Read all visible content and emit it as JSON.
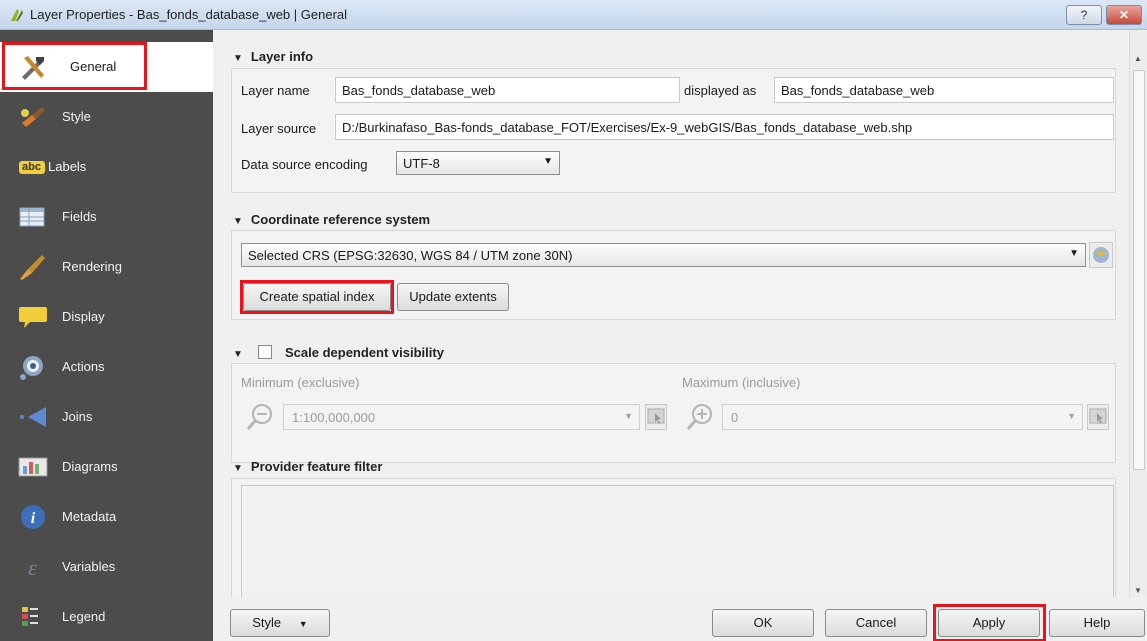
{
  "window": {
    "title": "Layer Properties - Bas_fonds_database_web | General",
    "help_glyph": "?",
    "close_glyph": "✕"
  },
  "sidebar": {
    "items": [
      {
        "label": "General",
        "icon": "tools-icon"
      },
      {
        "label": "Style",
        "icon": "paintbrush-icon"
      },
      {
        "label": "Labels",
        "icon": "abc-label-icon"
      },
      {
        "label": "Fields",
        "icon": "table-icon"
      },
      {
        "label": "Rendering",
        "icon": "brush-icon"
      },
      {
        "label": "Display",
        "icon": "speech-bubble-icon"
      },
      {
        "label": "Actions",
        "icon": "gear-icon"
      },
      {
        "label": "Joins",
        "icon": "join-icon"
      },
      {
        "label": "Diagrams",
        "icon": "diagram-icon"
      },
      {
        "label": "Metadata",
        "icon": "info-icon"
      },
      {
        "label": "Variables",
        "icon": "epsilon-icon"
      },
      {
        "label": "Legend",
        "icon": "legend-icon"
      }
    ],
    "abc_text": "abc"
  },
  "layer_info": {
    "title": "Layer info",
    "layer_name_label": "Layer name",
    "layer_name_value": "Bas_fonds_database_web",
    "displayed_as_label": "displayed as",
    "displayed_as_value": "Bas_fonds_database_web",
    "layer_source_label": "Layer source",
    "layer_source_value": "D:/Burkinafaso_Bas-fonds_database_FOT/Exercises/Ex-9_webGIS/Bas_fonds_database_web.shp",
    "encoding_label": "Data source encoding",
    "encoding_value": "UTF-8"
  },
  "crs": {
    "title": "Coordinate reference system",
    "selected": "Selected CRS (EPSG:32630, WGS 84 / UTM zone 30N)",
    "create_index_label": "Create spatial index",
    "update_extents_label": "Update extents"
  },
  "scale": {
    "title": "Scale dependent visibility",
    "min_label": "Minimum (exclusive)",
    "max_label": "Maximum (inclusive)",
    "min_value": "1:100,000,000",
    "max_value": "0"
  },
  "filter": {
    "title": "Provider feature filter"
  },
  "buttons": {
    "style": "Style",
    "ok": "OK",
    "cancel": "Cancel",
    "apply": "Apply",
    "help": "Help"
  },
  "colors": {
    "sidebar_bg": "#4c4c4c",
    "highlight": "#e8141c"
  }
}
